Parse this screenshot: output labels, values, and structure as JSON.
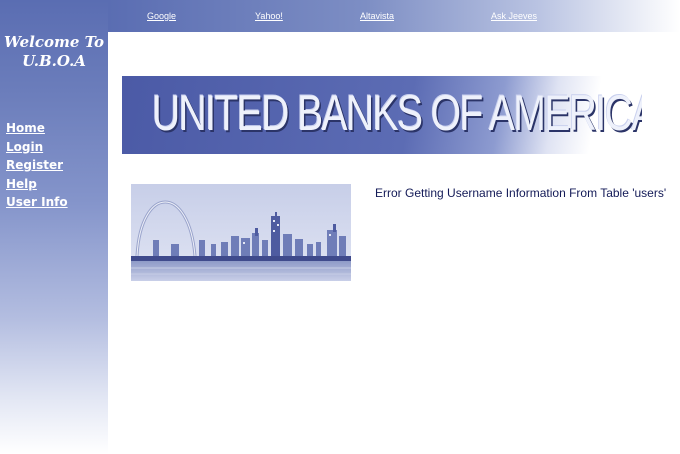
{
  "top_links": [
    "Google",
    "Yahoo!",
    "Altavista",
    "Ask Jeeves"
  ],
  "sidebar": {
    "welcome_line1": "Welcome To",
    "welcome_line2": "U.B.O.A",
    "nav": [
      "Home",
      "Login",
      "Register",
      "Help",
      "User Info"
    ]
  },
  "banner": {
    "text": "UNITED BANKS OF AMERICA"
  },
  "main": {
    "error_message": "Error Getting Username Information From Table 'users'"
  },
  "colors": {
    "theme_blue": "#5a6db2",
    "error_text": "#131a57"
  },
  "icons": {
    "city_image": "st-louis-skyline-image"
  }
}
